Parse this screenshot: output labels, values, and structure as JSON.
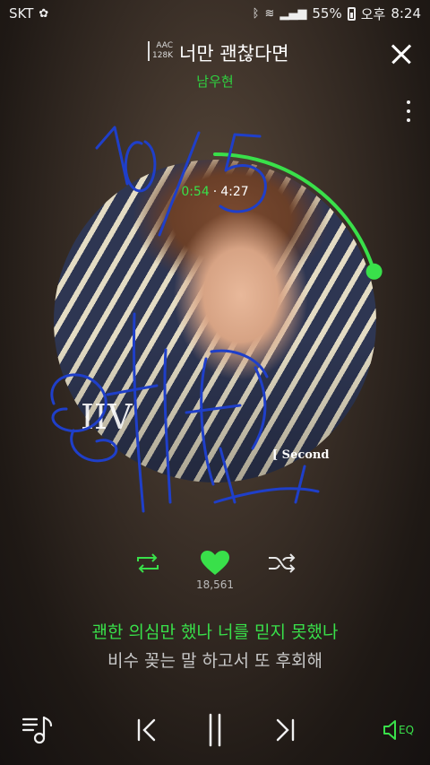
{
  "status_bar": {
    "carrier": "SKT",
    "battery": "55%",
    "ampm": "오후",
    "time": "8:24"
  },
  "header": {
    "quality_codec": "AAC",
    "quality_bitrate": "128K",
    "title": "너만 괜찮다면",
    "artist": "남우현"
  },
  "player": {
    "current_time": "0:54",
    "separator": "·",
    "total_time": "4:27",
    "progress": 0.202,
    "like_count": "18,561",
    "liked": true
  },
  "album_art": {
    "logo_text": "IIV",
    "subtitle_text": "[ Second"
  },
  "lyrics": {
    "current": "괜한 의심만 했나 너를 믿지 못했나",
    "next": "비수 꽂는 말 하고서 또 후회해"
  },
  "bottom_bar": {
    "eq_label": "EQ"
  },
  "colors": {
    "accent": "#39e04a",
    "ink_scribble": "#1f3fc9"
  },
  "icons": [
    "playlist-icon",
    "previous-icon",
    "pause-icon",
    "next-icon",
    "eq-icon",
    "repeat-icon",
    "heart-icon",
    "shuffle-icon",
    "close-icon",
    "more-icon"
  ]
}
